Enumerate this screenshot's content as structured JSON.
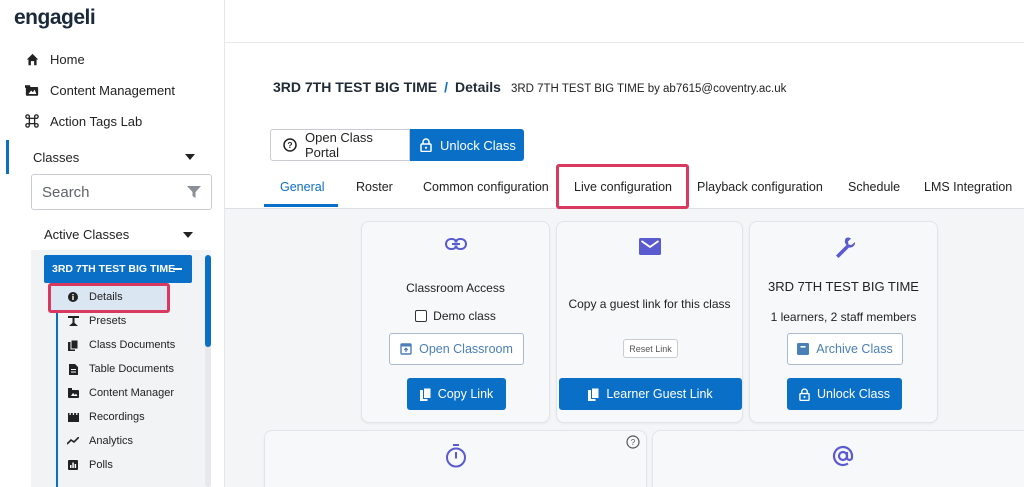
{
  "app": {
    "logo_text": "engageli"
  },
  "sidebar": {
    "nav": [
      {
        "label": "Home",
        "icon": "home-icon"
      },
      {
        "label": "Content Management",
        "icon": "folder-image-icon"
      },
      {
        "label": "Action Tags Lab",
        "icon": "tag-lab-icon"
      }
    ],
    "classes_label": "Classes",
    "search_placeholder": "Search",
    "active_classes_label": "Active Classes",
    "class_name": "3RD 7TH TEST BIG TIME",
    "sub_items": [
      {
        "label": "Details",
        "icon": "info-icon"
      },
      {
        "label": "Presets",
        "icon": "presets-icon"
      },
      {
        "label": "Class Documents",
        "icon": "documents-icon"
      },
      {
        "label": "Table Documents",
        "icon": "table-documents-icon"
      },
      {
        "label": "Content Manager",
        "icon": "content-manager-icon"
      },
      {
        "label": "Recordings",
        "icon": "recordings-icon"
      },
      {
        "label": "Analytics",
        "icon": "analytics-icon"
      },
      {
        "label": "Polls",
        "icon": "polls-icon"
      }
    ]
  },
  "header": {
    "class_title": "3RD 7TH TEST BIG TIME",
    "separator": "/",
    "page": "Details",
    "subtitle": "3RD 7TH TEST BIG TIME by ab7615@coventry.ac.uk"
  },
  "actions": {
    "open_portal": "Open Class Portal",
    "unlock": "Unlock Class"
  },
  "tabs": [
    {
      "label": "General",
      "active": true
    },
    {
      "label": "Roster",
      "active": false
    },
    {
      "label": "Common configuration",
      "active": false
    },
    {
      "label": "Live configuration",
      "active": false
    },
    {
      "label": "Playback configuration",
      "active": false
    },
    {
      "label": "Schedule",
      "active": false
    },
    {
      "label": "LMS Integration",
      "active": false
    }
  ],
  "cards": {
    "access": {
      "title": "Classroom Access",
      "demo_label": "Demo class",
      "demo_checked": false,
      "open_button": "Open Classroom",
      "copy_button": "Copy Link"
    },
    "guest": {
      "title": "Copy a guest link for this class",
      "reset_button": "Reset Link",
      "guest_button": "Learner Guest Link"
    },
    "class": {
      "title": "3RD 7TH TEST BIG TIME",
      "members": "1 learners, 2 staff members",
      "archive_button": "Archive Class",
      "unlock_button": "Unlock Class"
    }
  },
  "colors": {
    "primary": "#0a6fc7",
    "highlight": "#d9395f",
    "icon_purple": "#5a5ad1"
  }
}
